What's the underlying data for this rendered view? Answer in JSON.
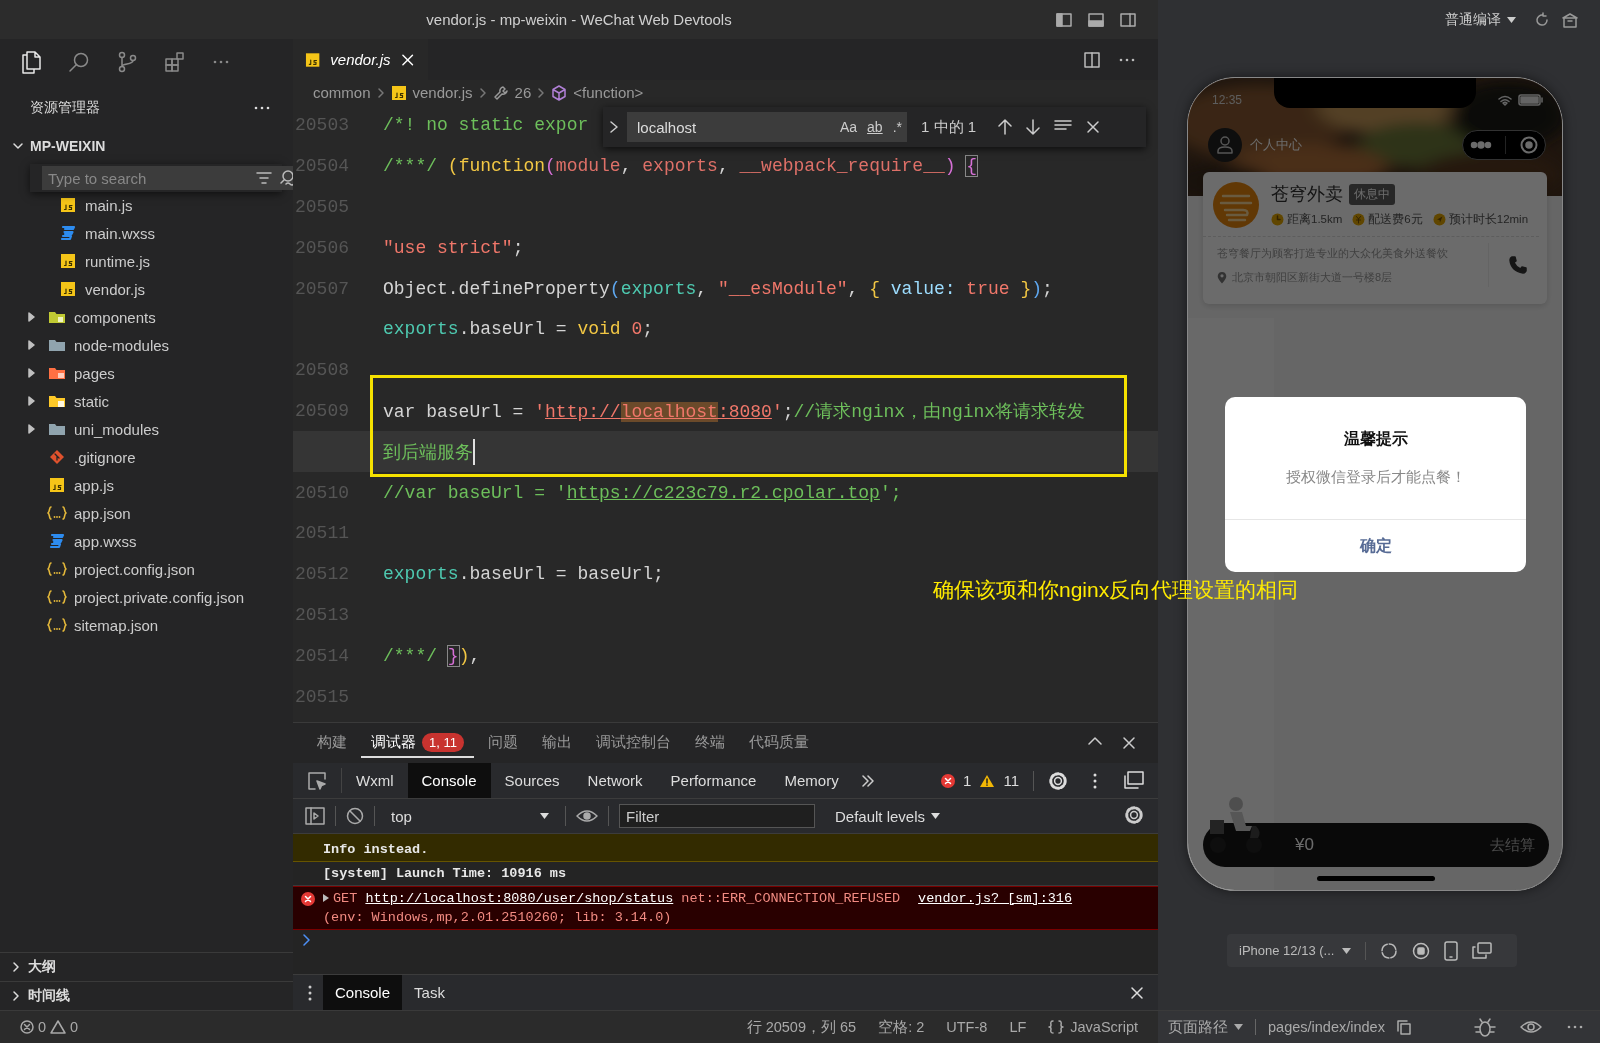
{
  "window": {
    "title": "vendor.js - mp-weixin - WeChat Web Devtools"
  },
  "sidebar": {
    "title": "资源管理器",
    "root": {
      "name": "MP-WEIXIN",
      "expanded": true
    },
    "search": {
      "placeholder": "Type to search"
    },
    "tree": [
      {
        "children": [
          {
            "name": "main.js",
            "kind": "js"
          },
          {
            "name": "main.wxss",
            "kind": "css"
          },
          {
            "name": "runtime.js",
            "kind": "js"
          },
          {
            "name": "vendor.js",
            "kind": "js"
          }
        ]
      },
      {
        "name": "components",
        "kind": "folder-components",
        "expanded": false
      },
      {
        "name": "node-modules",
        "kind": "folder",
        "expanded": false
      },
      {
        "name": "pages",
        "kind": "folder-pages",
        "expanded": false
      },
      {
        "name": "static",
        "kind": "folder-static",
        "expanded": false
      },
      {
        "name": "uni_modules",
        "kind": "folder",
        "expanded": false
      },
      {
        "name": ".gitignore",
        "kind": "git"
      },
      {
        "name": "app.js",
        "kind": "js"
      },
      {
        "name": "app.json",
        "kind": "json"
      },
      {
        "name": "app.wxss",
        "kind": "css"
      },
      {
        "name": "project.config.json",
        "kind": "json"
      },
      {
        "name": "project.private.config.json",
        "kind": "json"
      },
      {
        "name": "sitemap.json",
        "kind": "json"
      }
    ],
    "sections": [
      {
        "name": "大纲",
        "expanded": false
      },
      {
        "name": "时间线",
        "expanded": false
      }
    ]
  },
  "editor": {
    "tabs": [
      {
        "name": "vendor.js",
        "kind": "js",
        "selected": true
      }
    ],
    "breadcrumb": [
      {
        "text": "common",
        "kind": "folder"
      },
      {
        "text": "vendor.js",
        "kind": "js"
      },
      {
        "text": "26",
        "kind": "wrench"
      },
      {
        "text": "<function>",
        "kind": "cube"
      }
    ],
    "find": {
      "value": "localhost",
      "options": [
        "Aa",
        "ab",
        ".*"
      ],
      "count": "1 中的 1"
    },
    "lines": [
      {
        "number": "20503",
        "tokens": [
          {
            "t": "/*! no static expor",
            "kind": "c"
          }
        ]
      },
      {
        "number": "20504",
        "tokens": [
          {
            "t": "/***/ ",
            "kind": "c"
          },
          {
            "t": "(",
            "kind": "g"
          },
          {
            "t": "function",
            "kind": "kw"
          },
          {
            "t": "(",
            "kind": "m"
          },
          {
            "t": "module",
            "kind": "p"
          },
          {
            "t": ", ",
            "kind": "t"
          },
          {
            "t": "exports",
            "kind": "p"
          },
          {
            "t": ", ",
            "kind": "t"
          },
          {
            "t": "__webpack_require__",
            "kind": "p"
          },
          {
            "t": ") ",
            "kind": "m"
          },
          {
            "t": "{",
            "kind": "mbox"
          }
        ]
      },
      {
        "number": "20505"
      },
      {
        "number": "20506",
        "tokens": [
          {
            "t": "\"use strict\"",
            "kind": "s"
          },
          {
            "t": ";",
            "kind": "t"
          }
        ]
      },
      {
        "number": "20507",
        "tokens": [
          {
            "t": "Object.defineProperty",
            "kind": "t"
          },
          {
            "t": "(",
            "kind": "b"
          },
          {
            "t": "exports",
            "kind": "v"
          },
          {
            "t": ", ",
            "kind": "t"
          },
          {
            "t": "\"__esModule\"",
            "kind": "s"
          },
          {
            "t": ", ",
            "kind": "t"
          },
          {
            "t": "{",
            "kind": "g"
          },
          {
            "t": " value: ",
            "kind": "pr"
          },
          {
            "t": "true ",
            "kind": "s"
          },
          {
            "t": "}",
            "kind": "g"
          },
          {
            "t": ")",
            "kind": "b"
          },
          {
            "t": ";",
            "kind": "t"
          }
        ]
      },
      {
        "tokens": [
          {
            "t": "exports",
            "kind": "v"
          },
          {
            "t": ".baseUrl = ",
            "kind": "t"
          },
          {
            "t": "void ",
            "kind": "kw"
          },
          {
            "t": "0",
            "kind": "s"
          },
          {
            "t": ";",
            "kind": "t"
          }
        ]
      },
      {
        "number": "20508"
      },
      {
        "number": "20509",
        "tokens": [
          {
            "t": "var baseUrl = ",
            "kind": "t"
          },
          {
            "t": "'",
            "kind": "s"
          },
          {
            "t": "http://",
            "kind": "u"
          },
          {
            "t": "localhost",
            "kind": "um"
          },
          {
            "t": ":8080",
            "kind": "u"
          },
          {
            "t": "'",
            "kind": "s"
          },
          {
            "t": ";",
            "kind": "t"
          },
          {
            "t": "//请求nginx，由nginx将请求转发",
            "kind": "c"
          }
        ]
      },
      {
        "tokens": [
          {
            "t": "到后端服务",
            "kind": "c"
          }
        ],
        "current": true
      },
      {
        "number": "20510",
        "tokens": [
          {
            "t": "//var baseUrl = '",
            "kind": "c"
          },
          {
            "t": "https://c223c79.r2.cpolar.top",
            "kind": "cu"
          },
          {
            "t": "';",
            "kind": "c"
          }
        ]
      },
      {
        "number": "20511"
      },
      {
        "number": "20512",
        "tokens": [
          {
            "t": "exports",
            "kind": "v"
          },
          {
            "t": ".baseUrl = baseUrl;",
            "kind": "t"
          }
        ]
      },
      {
        "number": "20513"
      },
      {
        "number": "20514",
        "tokens": [
          {
            "t": "/***/ ",
            "kind": "c"
          },
          {
            "t": "}",
            "kind": "mbox"
          },
          {
            "t": ")",
            "kind": "g"
          },
          {
            "t": ",",
            "kind": "t"
          }
        ]
      },
      {
        "number": "20515"
      }
    ]
  },
  "annotation": {
    "text": "确保该项和你nginx反向代理设置的相同"
  },
  "panel": {
    "tabs": [
      {
        "label": "构建",
        "selected": false
      },
      {
        "label": "调试器",
        "selected": true,
        "badge": "1, 11"
      },
      {
        "label": "问题",
        "selected": false
      },
      {
        "label": "输出",
        "selected": false
      },
      {
        "label": "调试控制台",
        "selected": false
      },
      {
        "label": "终端",
        "selected": false
      },
      {
        "label": "代码质量",
        "selected": false
      }
    ],
    "devtools_tabs": [
      {
        "label": "Wxml",
        "selected": false
      },
      {
        "label": "Console",
        "selected": true
      },
      {
        "label": "Sources",
        "selected": false
      },
      {
        "label": "Network",
        "selected": false
      },
      {
        "label": "Performance",
        "selected": false
      },
      {
        "label": "Memory",
        "selected": false
      }
    ],
    "errors": "1",
    "warnings": "11",
    "context": "top",
    "filter": {
      "placeholder": "Filter"
    },
    "levels": "Default levels",
    "messages": [
      {
        "kind": "warning",
        "text": "Info instead."
      },
      {
        "kind": "info",
        "text": "[system] Launch Time: 10916 ms"
      },
      {
        "kind": "error",
        "method": "GET",
        "url": "http://localhost:8080/user/shop/status",
        "message": "net::ERR_CONNECTION_REFUSED",
        "source": "vendor.js? [sm]:316",
        "detail": "(env: Windows,mp,2.01.2510260; lib: 3.14.0)"
      }
    ],
    "drawer_tabs": [
      {
        "label": "Console",
        "selected": true
      },
      {
        "label": "Task",
        "selected": false
      }
    ]
  },
  "simulator": {
    "mode": "普通编译",
    "phone": {
      "time": "12:35",
      "profile": "个人中心",
      "shop": {
        "name": "苍穹外卖",
        "status": "休息中",
        "meta": [
          {
            "text": "距离1.5km",
            "kind": "clock"
          },
          {
            "text": "配送费6元",
            "kind": "coin"
          },
          {
            "text": "预计时长12min",
            "kind": "nav"
          }
        ],
        "description": "苍穹餐厅为顾客打造专业的大众化美食外送餐饮",
        "address": "北京市朝阳区新街大道一号楼8层"
      },
      "cart": {
        "total": "¥0",
        "checkout": "去结算"
      },
      "dialog": {
        "title": "温馨提示",
        "message": "授权微信登录后才能点餐！",
        "confirm": "确定"
      }
    },
    "device": "iPhone 12/13 (..."
  },
  "status_bar": {
    "errors": "0",
    "warnings": "0",
    "position": "行 20509，列 65",
    "indent": "空格: 2",
    "encoding": "UTF-8",
    "eol": "LF",
    "language": "JavaScript",
    "page_path_label": "页面路径",
    "page_path": "pages/index/index"
  }
}
